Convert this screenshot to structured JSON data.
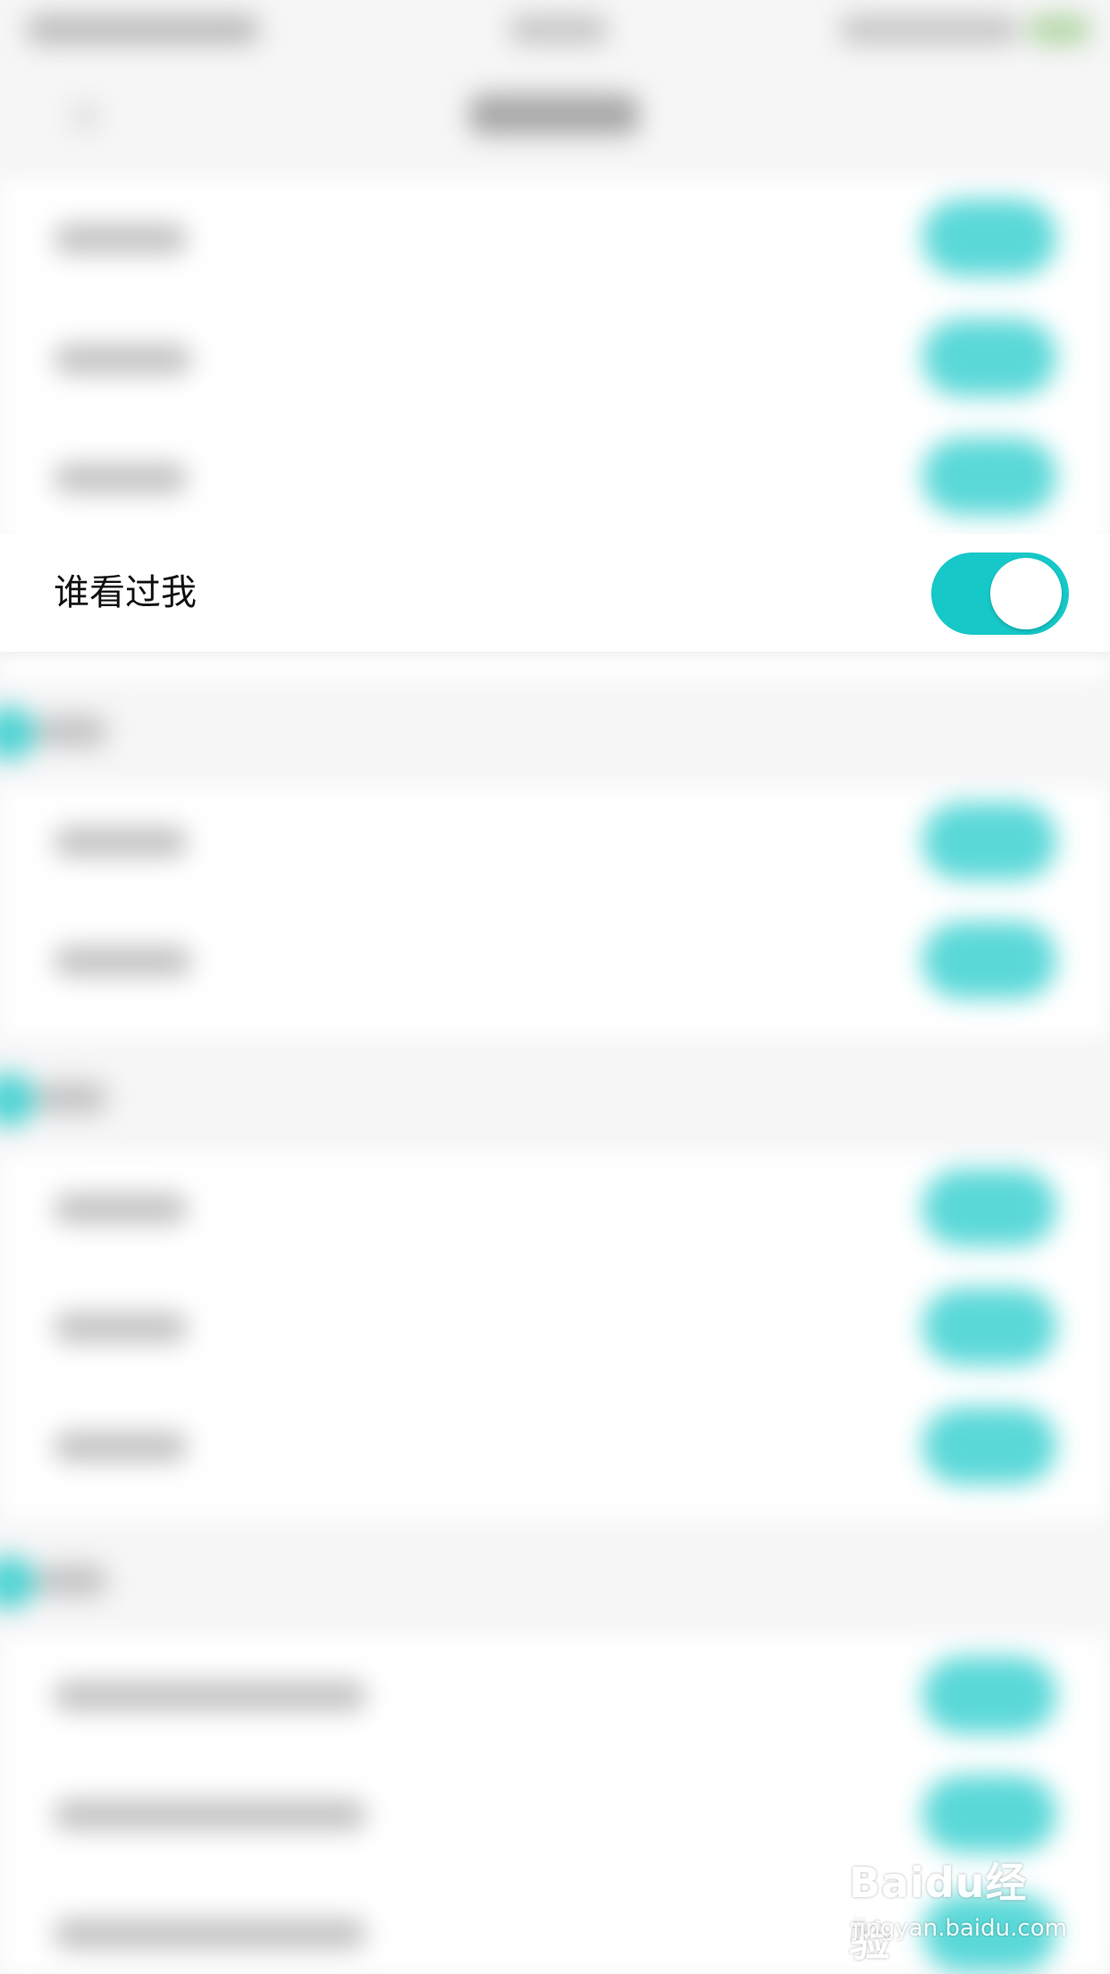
{
  "colors": {
    "accent": "#16c8c8",
    "background": "#f6f6f7",
    "row_background": "#ffffff",
    "text": "#111111"
  },
  "focused_setting": {
    "label": "谁看过我",
    "toggle": {
      "on": true
    }
  },
  "watermark": {
    "logo": "Baidu经验",
    "url": "jingyan.baidu.com"
  }
}
